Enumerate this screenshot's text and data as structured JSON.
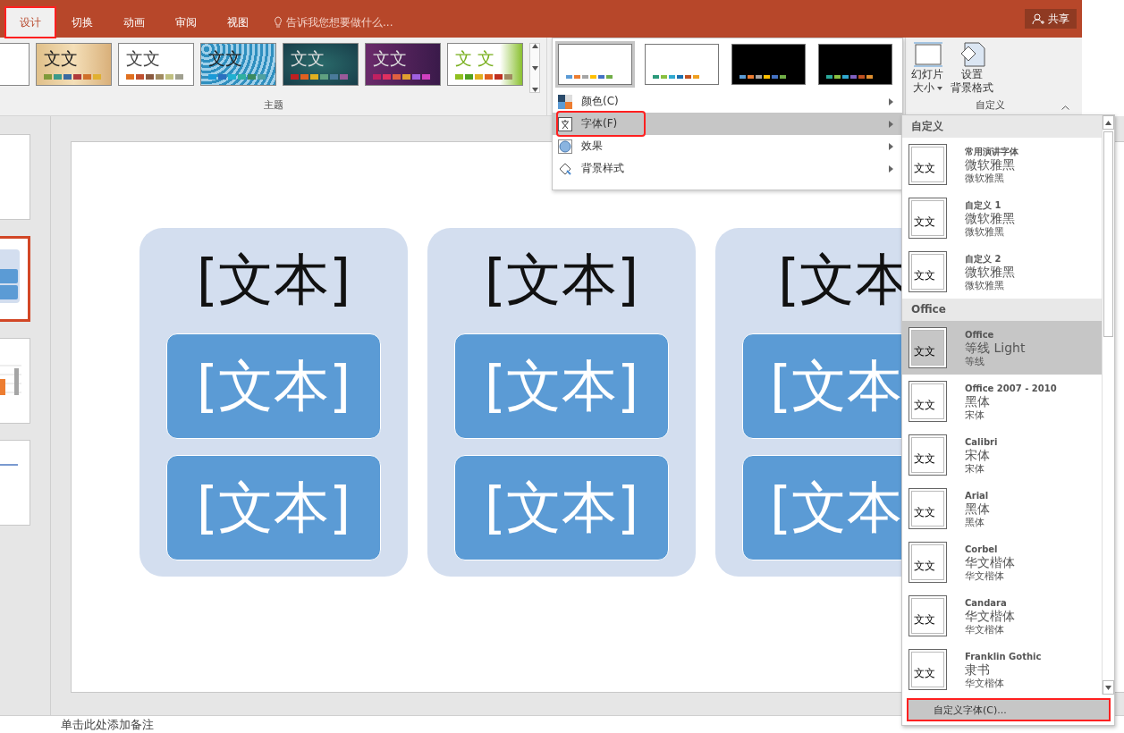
{
  "tabs": [
    {
      "label": "设计",
      "selected": true,
      "annotated": true
    },
    {
      "label": "切换",
      "selected": false,
      "annotated": false
    },
    {
      "label": "动画",
      "selected": false,
      "annotated": false
    },
    {
      "label": "审阅",
      "selected": false,
      "annotated": false
    },
    {
      "label": "视图",
      "selected": false,
      "annotated": false
    }
  ],
  "tell_me": {
    "placeholder": "告诉我您想要做什么..."
  },
  "share_button": "共享",
  "themes": {
    "label": "主题",
    "items": [
      {
        "kind": "plain"
      },
      {
        "kind": "wood",
        "text": "文文"
      },
      {
        "kind": "blank",
        "text": "文文"
      },
      {
        "kind": "pattern",
        "text": "文文"
      },
      {
        "kind": "teal",
        "text": "文文"
      },
      {
        "kind": "purple",
        "text": "文文"
      },
      {
        "kind": "green",
        "text": "文 文"
      }
    ]
  },
  "variants": [
    {
      "kind": "office",
      "selected": true
    },
    {
      "kind": "fresh",
      "selected": false
    },
    {
      "kind": "midnight",
      "selected": false
    },
    {
      "kind": "ocean",
      "selected": false
    }
  ],
  "variant_menu": [
    {
      "kind": "colors",
      "label": "颜色(C)",
      "selected": false,
      "annotated": false
    },
    {
      "kind": "fonts",
      "label": "字体(F)",
      "selected": true,
      "annotated": true
    },
    {
      "kind": "effects",
      "label": "效果",
      "selected": false,
      "annotated": false
    },
    {
      "kind": "background",
      "label": "背景样式",
      "selected": false,
      "annotated": false
    }
  ],
  "customize": {
    "label": "自定义",
    "buttons": [
      {
        "kind": "size",
        "lines": [
          "幻灯片",
          "大小"
        ]
      },
      {
        "kind": "format",
        "lines": [
          "设置",
          "背景格式"
        ]
      }
    ]
  },
  "slides": [
    {
      "kind": "blank",
      "selected": false
    },
    {
      "kind": "cards",
      "selected": true
    },
    {
      "kind": "chart",
      "selected": false
    },
    {
      "kind": "link",
      "selected": false
    }
  ],
  "slide_cards": [
    {
      "title": "[文本]",
      "boxes": [
        "[文本]",
        "[文本]"
      ]
    },
    {
      "title": "[文本]",
      "boxes": [
        "[文本]",
        "[文本]"
      ]
    },
    {
      "title": "[文本",
      "boxes": [
        "[文本",
        "[文本"
      ]
    }
  ],
  "font_menu": {
    "sections": [
      {
        "title": "自定义",
        "items": [
          {
            "name": "常用演讲字体",
            "heading": "微软雅黑",
            "body": "微软雅黑",
            "preview": "文文",
            "selected": false
          },
          {
            "name": "自定义 1",
            "heading": "微软雅黑",
            "body": "微软雅黑",
            "preview": "文文",
            "selected": false
          },
          {
            "name": "自定义 2",
            "heading": "微软雅黑",
            "body": "微软雅黑",
            "preview": "文文",
            "selected": false
          }
        ]
      },
      {
        "title": "Office",
        "items": [
          {
            "name": "Office",
            "heading": "等线 Light",
            "body": "等线",
            "preview": "文文",
            "selected": true
          },
          {
            "name": "Office 2007 - 2010",
            "heading": "黑体",
            "body": "宋体",
            "preview": "文文",
            "selected": false
          },
          {
            "name": "Calibri",
            "heading": "宋体",
            "body": "宋体",
            "preview": "文文",
            "selected": false
          },
          {
            "name": "Arial",
            "heading": "黑体",
            "body": "黑体",
            "preview": "文文",
            "selected": false
          },
          {
            "name": "Corbel",
            "heading": "华文楷体",
            "body": "华文楷体",
            "preview": "文文",
            "selected": false
          },
          {
            "name": "Candara",
            "heading": "华文楷体",
            "body": "华文楷体",
            "preview": "文文",
            "selected": false
          },
          {
            "name": "Franklin Gothic",
            "heading": "隶书",
            "body": "华文楷体",
            "preview": "文文",
            "selected": false
          }
        ]
      }
    ],
    "footer": {
      "label": "自定义字体(C)...",
      "annotated": true
    }
  },
  "notes": {
    "placeholder": "单击此处添加备注"
  }
}
